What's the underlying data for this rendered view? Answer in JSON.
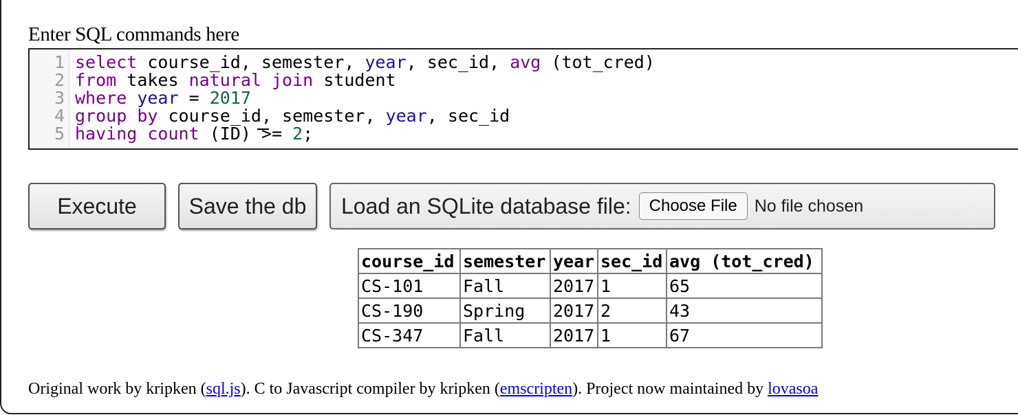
{
  "heading": "Enter SQL commands here",
  "editor": {
    "lines": [
      {
        "n": "1",
        "tokens": [
          {
            "t": "select",
            "c": "kw"
          },
          {
            "t": " course_id, semester, ",
            "c": ""
          },
          {
            "t": "year",
            "c": "bi"
          },
          {
            "t": ", sec_id, ",
            "c": ""
          },
          {
            "t": "avg",
            "c": "kw"
          },
          {
            "t": " (tot_cred)",
            "c": ""
          }
        ]
      },
      {
        "n": "2",
        "tokens": [
          {
            "t": "from",
            "c": "kw"
          },
          {
            "t": " takes ",
            "c": ""
          },
          {
            "t": "natural",
            "c": "kw"
          },
          {
            "t": " ",
            "c": ""
          },
          {
            "t": "join",
            "c": "kw"
          },
          {
            "t": " student",
            "c": ""
          }
        ]
      },
      {
        "n": "3",
        "tokens": [
          {
            "t": "where",
            "c": "kw"
          },
          {
            "t": " ",
            "c": ""
          },
          {
            "t": "year",
            "c": "bi"
          },
          {
            "t": " = ",
            "c": ""
          },
          {
            "t": "2017",
            "c": "num"
          }
        ]
      },
      {
        "n": "4",
        "tokens": [
          {
            "t": "group",
            "c": "kw"
          },
          {
            "t": " ",
            "c": ""
          },
          {
            "t": "by",
            "c": "kw"
          },
          {
            "t": " course_id, semester, ",
            "c": ""
          },
          {
            "t": "year",
            "c": "bi"
          },
          {
            "t": ", sec_id",
            "c": ""
          }
        ]
      },
      {
        "n": "5",
        "tokens": [
          {
            "t": "having",
            "c": "kw"
          },
          {
            "t": " ",
            "c": ""
          },
          {
            "t": "count",
            "c": "kw"
          },
          {
            "t": " (ID) >= ",
            "c": ""
          },
          {
            "t": "2",
            "c": "num"
          },
          {
            "t": ";",
            "c": ""
          }
        ]
      }
    ]
  },
  "buttons": {
    "execute": "Execute",
    "save": "Save the db",
    "load_label": "Load an SQLite database file:",
    "choose_file": "Choose File",
    "no_file": "No file chosen"
  },
  "results": {
    "columns": [
      "course_id",
      "semester",
      "year",
      "sec_id",
      "avg (tot_cred)"
    ],
    "rows": [
      [
        "CS-101",
        "Fall",
        "2017",
        "1",
        "65"
      ],
      [
        "CS-190",
        "Spring",
        "2017",
        "2",
        "43"
      ],
      [
        "CS-347",
        "Fall",
        "2017",
        "1",
        "67"
      ]
    ]
  },
  "footer": {
    "t1": "Original work by kripken (",
    "link1": "sql.js",
    "t2": "). C to Javascript compiler by kripken (",
    "link2": "emscripten",
    "t3": "). Project now maintained by ",
    "link3": "lovasoa"
  },
  "colors": {
    "keyword": "#770088",
    "builtin": "#221199",
    "number": "#116644",
    "link": "#0000ee"
  }
}
